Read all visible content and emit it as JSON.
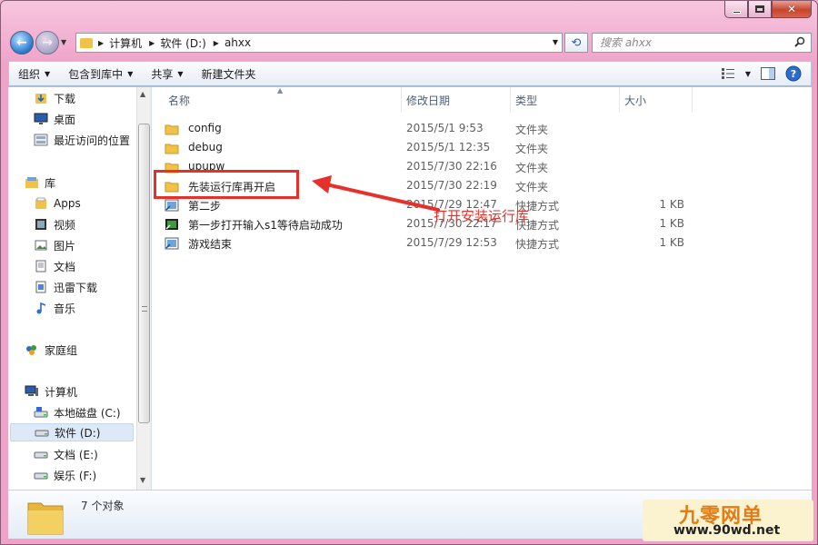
{
  "window": {
    "caption": {
      "minimize": "—",
      "maximize": "□",
      "close": "✕"
    }
  },
  "address": {
    "crumbs": [
      "计算机",
      "软件 (D:)",
      "ahxx"
    ]
  },
  "search": {
    "placeholder": "搜索 ahxx"
  },
  "toolbar": {
    "items": [
      {
        "label": "组织",
        "has_caret": true
      },
      {
        "label": "包含到库中",
        "has_caret": true
      },
      {
        "label": "共享",
        "has_caret": true
      },
      {
        "label": "新建文件夹",
        "has_caret": false
      }
    ]
  },
  "navpane": {
    "items": [
      {
        "label": "下载",
        "icon": "download-folder-icon"
      },
      {
        "label": "桌面",
        "icon": "desktop-icon"
      },
      {
        "label": "最近访问的位置",
        "icon": "recent-places-icon"
      },
      {
        "label": "库",
        "icon": "libraries-icon",
        "group": true
      },
      {
        "label": "Apps",
        "icon": "apps-library-icon"
      },
      {
        "label": "视频",
        "icon": "video-library-icon"
      },
      {
        "label": "图片",
        "icon": "pictures-library-icon"
      },
      {
        "label": "文档",
        "icon": "documents-library-icon"
      },
      {
        "label": "迅雷下载",
        "icon": "thunder-download-icon"
      },
      {
        "label": "音乐",
        "icon": "music-library-icon"
      },
      {
        "label": "家庭组",
        "icon": "homegroup-icon",
        "group": true
      },
      {
        "label": "计算机",
        "icon": "computer-icon",
        "group": true
      },
      {
        "label": "本地磁盘 (C:)",
        "icon": "drive-c-icon"
      },
      {
        "label": "软件 (D:)",
        "icon": "drive-d-icon",
        "selected": true
      },
      {
        "label": "文档 (E:)",
        "icon": "drive-e-icon"
      },
      {
        "label": "娱乐 (F:)",
        "icon": "drive-f-icon"
      }
    ]
  },
  "columns": {
    "name": "名称",
    "modified": "修改日期",
    "type": "类型",
    "size": "大小"
  },
  "files": [
    {
      "name": "config",
      "modified": "2015/5/1 9:53",
      "type": "文件夹",
      "size": "",
      "icon": "folder-icon"
    },
    {
      "name": "debug",
      "modified": "2015/5/1 12:35",
      "type": "文件夹",
      "size": "",
      "icon": "folder-icon"
    },
    {
      "name": "upupw",
      "modified": "2015/7/30 22:16",
      "type": "文件夹",
      "size": "",
      "icon": "folder-icon"
    },
    {
      "name": "先装运行库再开启",
      "modified": "2015/7/30 22:19",
      "type": "文件夹",
      "size": "",
      "icon": "folder-icon"
    },
    {
      "name": "第二步",
      "modified": "2015/7/29 12:47",
      "type": "快捷方式",
      "size": "1 KB",
      "icon": "shortcut-icon"
    },
    {
      "name": "第一步打开输入s1等待启动成功",
      "modified": "2015/7/30 22:17",
      "type": "快捷方式",
      "size": "1 KB",
      "icon": "shortcut-app-icon"
    },
    {
      "name": "游戏结束",
      "modified": "2015/7/29 12:53",
      "type": "快捷方式",
      "size": "1 KB",
      "icon": "shortcut-icon"
    }
  ],
  "annotation": {
    "text": "打开安装运行库",
    "color": "#e8302b"
  },
  "status": {
    "count": "7 个对象"
  },
  "watermark": {
    "brand": "九零网单",
    "url": "www.90wd.net"
  },
  "colors": {
    "titlebar": "#f4b8d6",
    "accent": "#e8302b",
    "selection": "#dde9f7"
  }
}
